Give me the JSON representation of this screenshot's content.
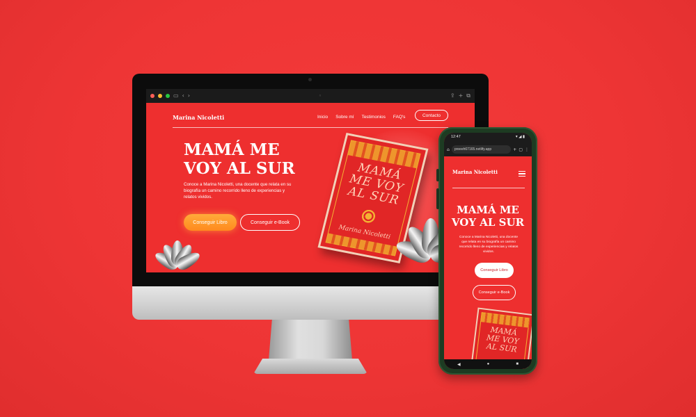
{
  "desktop": {
    "browser": {
      "address_icon": "lock-icon"
    },
    "site": {
      "brand": "Marina Nicoletti",
      "nav": [
        "Inicio",
        "Sobre mí",
        "Testimonios",
        "FAQ's"
      ],
      "contact_label": "Contacto",
      "title_line1": "MAMÁ ME",
      "title_line2": "VOY AL SUR",
      "description": "Conoce a Marina Nicoletti, una docente que relata en su biografía un camino recorrido lleno de experiencias y relatos vividos.",
      "primary_button": "Conseguir Libro",
      "secondary_button": "Conseguir e-Book",
      "book": {
        "title_line1": "MAMÁ",
        "title_line2": "ME VOY",
        "title_line3": "AL SUR",
        "author": "Marina Nicoletti"
      }
    }
  },
  "mobile": {
    "status": {
      "time": "12:47",
      "icons": "▾ ◢ ▮"
    },
    "url": "preeeh67165.netlify.app",
    "brand": "Marina Nicoletti",
    "title_line1": "MAMÁ ME",
    "title_line2": "VOY AL SUR",
    "description": "Conoce a Marina Nicoletti, una docente que relata en su biografía un camino recorrido lleno de experiencias y relatos vividos.",
    "primary_button": "Conseguir Libro",
    "secondary_button": "Conseguir e-Book",
    "book": {
      "title_line1": "MAMÁ",
      "title_line2": "ME VOY",
      "title_line3": "AL SUR"
    }
  },
  "colors": {
    "background": "#ee3535",
    "accent_orange": "#ff9a2a",
    "book_gold": "#f4b233"
  }
}
